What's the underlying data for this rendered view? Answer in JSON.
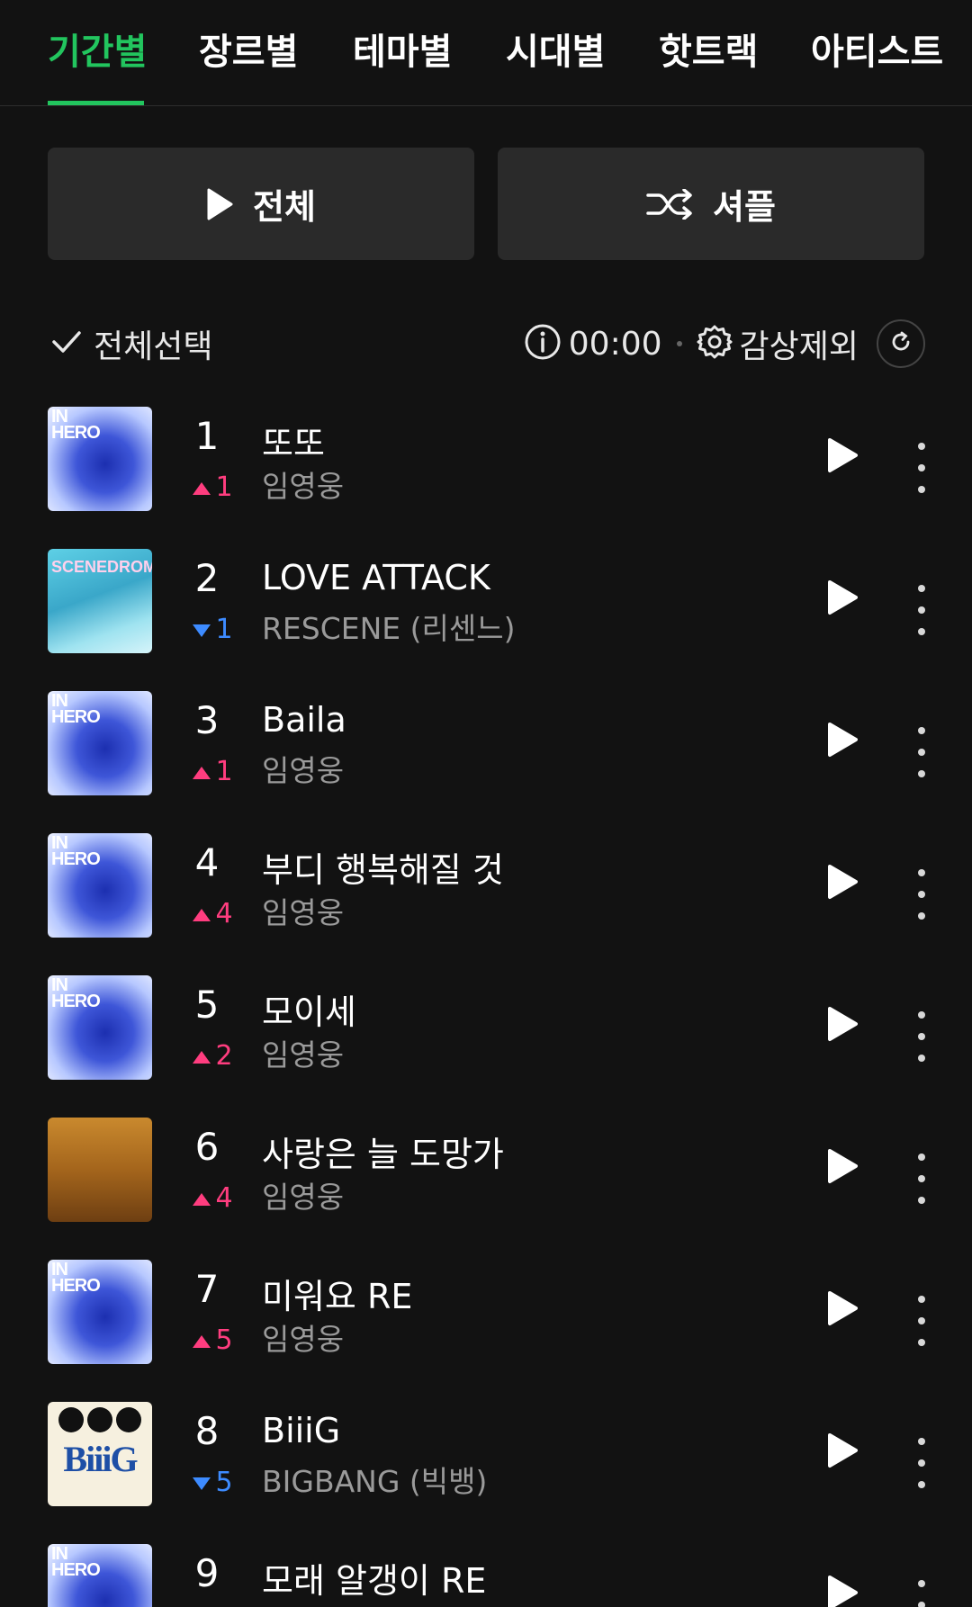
{
  "tabs": [
    {
      "label": "기간별",
      "active": true
    },
    {
      "label": "장르별",
      "active": false
    },
    {
      "label": "테마별",
      "active": false
    },
    {
      "label": "시대별",
      "active": false
    },
    {
      "label": "핫트랙",
      "active": false
    },
    {
      "label": "아티스트",
      "active": false
    }
  ],
  "buttons": {
    "play_all": {
      "label": "전체",
      "icon": "play-icon"
    },
    "shuffle": {
      "label": "셔플",
      "icon": "shuffle-icon"
    }
  },
  "toolbar": {
    "select_all": "전체선택",
    "time": "00:00",
    "exclude": "감상제외"
  },
  "colors": {
    "accent": "#22c55e",
    "rank_up": "#ff3d7f",
    "rank_down": "#3d8bff",
    "background": "#121212"
  },
  "tracks": [
    {
      "rank": "1",
      "change": "1",
      "direction": "up",
      "title": "또또",
      "artist": "임영웅",
      "cover": "hero"
    },
    {
      "rank": "2",
      "change": "1",
      "direction": "down",
      "title": "LOVE ATTACK",
      "artist": "RESCENE (리센느)",
      "cover": "scene"
    },
    {
      "rank": "3",
      "change": "1",
      "direction": "up",
      "title": "Baila",
      "artist": "임영웅",
      "cover": "hero"
    },
    {
      "rank": "4",
      "change": "4",
      "direction": "up",
      "title": "부디 행복해질 것",
      "artist": "임영웅",
      "cover": "hero"
    },
    {
      "rank": "5",
      "change": "2",
      "direction": "up",
      "title": "모이세",
      "artist": "임영웅",
      "cover": "hero"
    },
    {
      "rank": "6",
      "change": "4",
      "direction": "up",
      "title": "사랑은 늘 도망가",
      "artist": "임영웅",
      "cover": "sunset"
    },
    {
      "rank": "7",
      "change": "5",
      "direction": "up",
      "title": "미워요 RE",
      "artist": "임영웅",
      "cover": "hero"
    },
    {
      "rank": "8",
      "change": "5",
      "direction": "down",
      "title": "BiiiG",
      "artist": "BIGBANG (빅뱅)",
      "cover": "bigbang"
    },
    {
      "rank": "9",
      "change": "",
      "direction": "",
      "title": "모래 알갱이 RE",
      "artist": "",
      "cover": "hero"
    }
  ]
}
